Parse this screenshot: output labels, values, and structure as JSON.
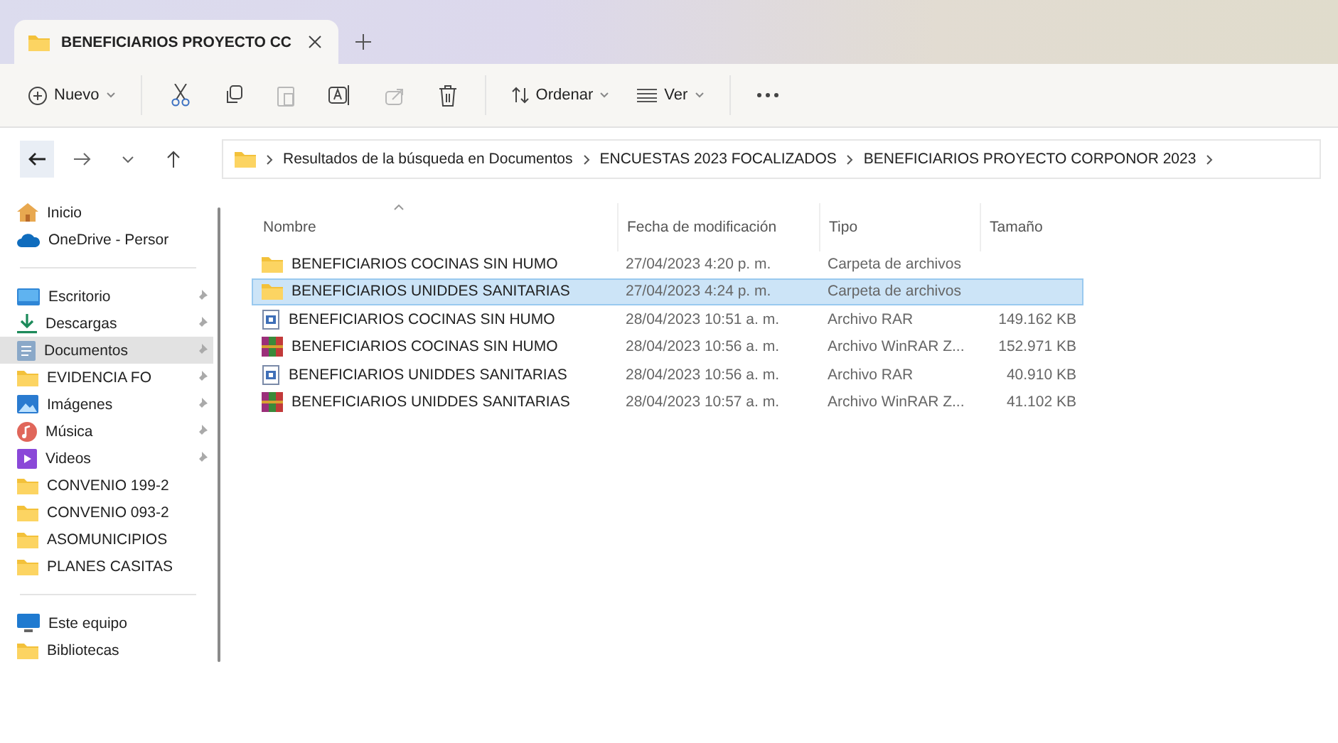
{
  "tabs": [
    {
      "title": "BENEFICIARIOS PROYECTO CC",
      "selected": true
    }
  ],
  "toolbar": {
    "new_label": "Nuevo",
    "actions": [
      {
        "kind": "cut",
        "disabled": false
      },
      {
        "kind": "copy",
        "disabled": false
      },
      {
        "kind": "paste",
        "disabled": true
      },
      {
        "kind": "rename",
        "disabled": false
      },
      {
        "kind": "share",
        "disabled": true
      },
      {
        "kind": "delete",
        "disabled": false
      }
    ],
    "sort_label": "Ordenar",
    "view_label": "Ver"
  },
  "breadcrumb": [
    "Resultados de la búsqueda en Documentos",
    "ENCUESTAS 2023 FOCALIZADOS",
    "BENEFICIARIOS PROYECTO CORPONOR 2023"
  ],
  "sidebar": {
    "groups": [
      [
        {
          "kind": "home",
          "label": "Inicio",
          "pinned": false,
          "selected": false
        },
        {
          "kind": "cloud",
          "label": "OneDrive - Persor",
          "pinned": false,
          "selected": false
        }
      ],
      [
        {
          "kind": "desktop",
          "label": "Escritorio",
          "pinned": true,
          "selected": false
        },
        {
          "kind": "download",
          "label": "Descargas",
          "pinned": true,
          "selected": false
        },
        {
          "kind": "documents",
          "label": "Documentos",
          "pinned": true,
          "selected": true
        },
        {
          "kind": "folder",
          "label": "EVIDENCIA FO",
          "pinned": true,
          "selected": false
        },
        {
          "kind": "images",
          "label": "Imágenes",
          "pinned": true,
          "selected": false
        },
        {
          "kind": "music",
          "label": "Música",
          "pinned": true,
          "selected": false
        },
        {
          "kind": "videos",
          "label": "Videos",
          "pinned": true,
          "selected": false
        },
        {
          "kind": "folder",
          "label": "CONVENIO 199-2",
          "pinned": false,
          "selected": false
        },
        {
          "kind": "folder",
          "label": "CONVENIO 093-2",
          "pinned": false,
          "selected": false
        },
        {
          "kind": "folder",
          "label": "ASOMUNICIPIOS",
          "pinned": false,
          "selected": false
        },
        {
          "kind": "folder",
          "label": "PLANES CASITAS",
          "pinned": false,
          "selected": false
        }
      ],
      [
        {
          "kind": "pc",
          "label": "Este equipo",
          "pinned": false,
          "selected": false
        },
        {
          "kind": "folder",
          "label": "Bibliotecas",
          "pinned": false,
          "selected": false
        }
      ]
    ]
  },
  "table": {
    "columns": [
      "Nombre",
      "Fecha de modificación",
      "Tipo",
      "Tamaño"
    ],
    "rows": [
      {
        "kind": "folder",
        "name": "BENEFICIARIOS COCINAS SIN HUMO",
        "date": "27/04/2023 4:20 p. m.",
        "type": "Carpeta de archivos",
        "selected": false
      },
      {
        "kind": "folder",
        "name": "BENEFICIARIOS UNIDDES SANITARIAS",
        "date": "27/04/2023 4:24 p. m.",
        "type": "Carpeta de archivos",
        "selected": true
      },
      {
        "kind": "rar",
        "name": "BENEFICIARIOS COCINAS SIN HUMO",
        "date": "28/04/2023 10:51 a. m.",
        "type": "Archivo RAR",
        "size": "149.162 KB",
        "selected": false
      },
      {
        "kind": "winrar",
        "name": "BENEFICIARIOS COCINAS SIN HUMO",
        "date": "28/04/2023 10:56 a. m.",
        "type": "Archivo WinRAR Z...",
        "size": "152.971 KB",
        "selected": false
      },
      {
        "kind": "rar",
        "name": "BENEFICIARIOS UNIDDES SANITARIAS",
        "date": "28/04/2023 10:56 a. m.",
        "type": "Archivo RAR",
        "size": "40.910 KB",
        "selected": false
      },
      {
        "kind": "winrar",
        "name": "BENEFICIARIOS UNIDDES SANITARIAS",
        "date": "28/04/2023 10:57 a. m.",
        "type": "Archivo WinRAR Z...",
        "size": "41.102 KB",
        "selected": false
      }
    ]
  }
}
